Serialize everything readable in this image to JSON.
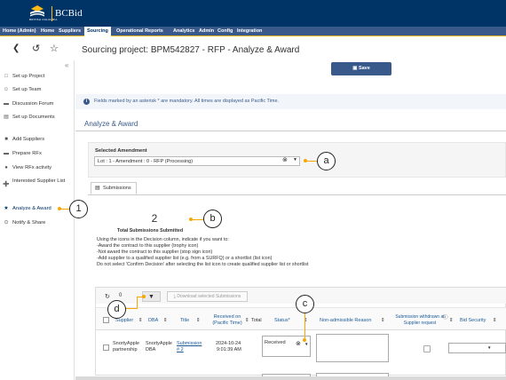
{
  "header": {
    "logo_text": "BRITISH COLUMBIA",
    "app_name": "BCBid"
  },
  "menu": [
    {
      "label": "Home (Admin)",
      "active": false
    },
    {
      "label": "Home",
      "active": false
    },
    {
      "label": "Suppliers",
      "active": false
    },
    {
      "label": "Sourcing",
      "active": true
    },
    {
      "label": "Operational Reports",
      "active": false
    },
    {
      "label": "Analytics",
      "active": false
    },
    {
      "label": "Admin",
      "active": false
    },
    {
      "label": "Config",
      "active": false
    },
    {
      "label": "Integration",
      "active": false
    }
  ],
  "page": {
    "title": "Sourcing project: BPM542827 - RFP - Analyze & Award",
    "back_icon": "back-arrow-icon",
    "history_icon": "undo-icon",
    "favorite_icon": "star-icon"
  },
  "sidebar": {
    "collapse_glyph": "«",
    "items": [
      {
        "label": "Set up Project",
        "icon": "clipboard-icon",
        "active": false
      },
      {
        "label": "Set up Team",
        "icon": "team-icon",
        "active": false
      },
      {
        "label": "Discussion Forum",
        "icon": "chat-icon",
        "active": false
      },
      {
        "label": "Set up Documents",
        "icon": "document-icon",
        "active": false
      },
      {
        "label": "Add Suppliers",
        "icon": "truck-icon",
        "active": false
      },
      {
        "label": "Prepare RFx",
        "icon": "folder-icon",
        "active": false
      },
      {
        "label": "View RFx activity",
        "icon": "binoculars-icon",
        "active": false
      },
      {
        "label": "Interested Supplier List",
        "icon": "user-plus-icon",
        "active": false
      },
      {
        "label": "Analyze & Award",
        "icon": "trophy-icon",
        "active": true
      },
      {
        "label": "Notify & Share",
        "icon": "share-icon",
        "active": false
      }
    ]
  },
  "toolbar": {
    "save_label": "Save"
  },
  "info": {
    "text": "Fields marked by an asterisk * are mandatory. All times are displayed as Pacific Time."
  },
  "section": {
    "title": "Analyze & Award",
    "amendment_label": "Selected Amendment",
    "amendment_value": "Lot : 1 - Amendment : 0 - RFP (Processing)"
  },
  "tabs": [
    {
      "label": "Submissions",
      "icon": "submissions-icon"
    }
  ],
  "summary": {
    "count": "2",
    "label": "Total Submissions Submitted"
  },
  "instructions": [
    "Using the icons in the Decision column, indicate if you want to:",
    "-Award the contract to this supplier (trophy icon)",
    "-Not award the contract to this supplier (stop sign icon)",
    "-Add supplier to a qualified supplier list (e.g. from a SURFQ) or a shortlist (list icon)",
    "Do not select 'Confirm Decision' after selecting the list icon to create qualified supplier list or shortlist"
  ],
  "grid": {
    "refresh_count": "0",
    "download_label": "Download selected Submissions",
    "columns": {
      "supplier": "Supplier",
      "dba": "DBA",
      "title": "Title",
      "received_on": "Received on (Pacific Time)",
      "total": "Total",
      "status": "Status*",
      "non_admissible": "Non-admissible Reason",
      "withdrawn": "Submission withdrawn at Supplier request",
      "bid_security": "Bid Security"
    },
    "rows": [
      {
        "supplier": "SnortyApple partnership",
        "dba": "SnortyApple DBA",
        "title": "Submission # 2",
        "received_date": "2024-10-24",
        "received_time": "9:01:39 AM",
        "status": "Received"
      }
    ]
  },
  "callouts": {
    "a": "a",
    "b": "b",
    "c": "c",
    "d": "d",
    "one": "1"
  },
  "colors": {
    "header": "#003366",
    "menu": "#38598a",
    "accent": "#fcba19",
    "callout": "#f6a800",
    "link": "#1a5a96"
  }
}
